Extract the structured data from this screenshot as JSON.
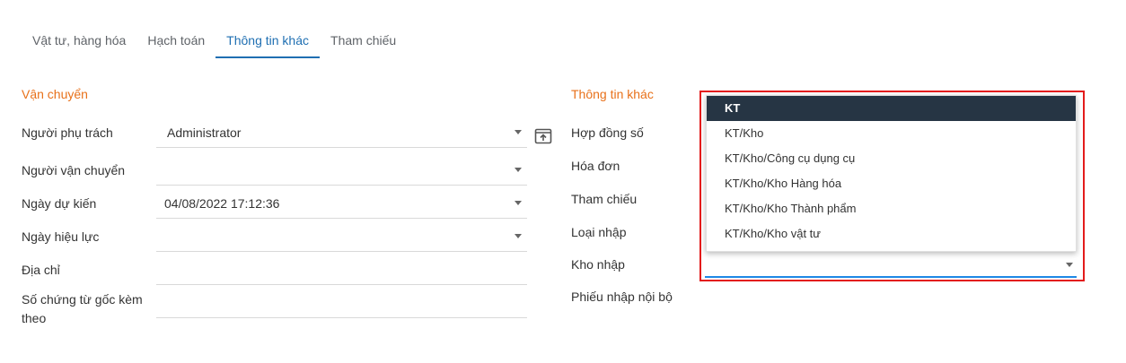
{
  "tabs": [
    {
      "label": "Vật tư, hàng hóa"
    },
    {
      "label": "Hạch toán"
    },
    {
      "label": "Thông tin khác"
    },
    {
      "label": "Tham chiếu"
    }
  ],
  "active_tab": "Thông tin khác",
  "left_section": {
    "title": "Vận chuyển",
    "fields": {
      "person_in_charge": {
        "label": "Người phụ trách",
        "value": "Administrator"
      },
      "carrier": {
        "label": "Người vận chuyển",
        "value": ""
      },
      "expected_date": {
        "label": "Ngày dự kiến",
        "value": "04/08/2022 17:12:36"
      },
      "effective_date": {
        "label": "Ngày hiệu lực",
        "value": ""
      },
      "address": {
        "label": "Địa chỉ",
        "value": ""
      },
      "source_docs": {
        "label_line1": "Số chứng từ gốc kèm",
        "label_line2": "theo",
        "value": ""
      }
    }
  },
  "right_section": {
    "title": "Thông tin khác",
    "labels": {
      "contract_no": "Hợp đồng số",
      "invoice": "Hóa đơn",
      "reference": "Tham chiếu",
      "import_type": "Loại nhập",
      "warehouse": "Kho nhập",
      "internal_receipt": "Phiếu nhập nội bộ"
    }
  },
  "warehouse_dropdown": {
    "options": [
      {
        "label": "KT",
        "selected": true
      },
      {
        "label": "KT/Kho",
        "selected": false
      },
      {
        "label": "KT/Kho/Công cụ dụng cụ",
        "selected": false
      },
      {
        "label": "KT/Kho/Kho Hàng hóa",
        "selected": false
      },
      {
        "label": "KT/Kho/Kho Thành phẩm",
        "selected": false
      },
      {
        "label": "KT/Kho/Kho vật tư",
        "selected": false
      }
    ]
  },
  "colors": {
    "accent_blue": "#1f6fb2",
    "section_orange": "#e8711a",
    "highlight_red": "#e31b1b",
    "selected_bg": "#263544",
    "focus_blue": "#1e88e5"
  }
}
